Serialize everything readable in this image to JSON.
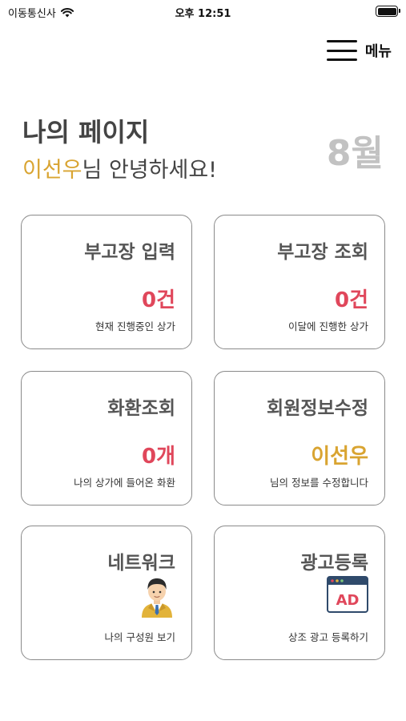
{
  "status_bar": {
    "carrier": "이동통신사",
    "time": "오후 12:51",
    "icons": [
      "wifi-icon",
      "battery-icon"
    ]
  },
  "header": {
    "menu_label": "메뉴",
    "menu_icon": "hamburger-icon"
  },
  "intro": {
    "title": "나의 페이지",
    "user_name": "이선우",
    "greeting_suffix": "님 안녕하세요!",
    "month": "8월"
  },
  "colors": {
    "accent_red": "#e0475b",
    "accent_gold": "#d9a431",
    "month_gray": "#c2c2c2"
  },
  "cards": [
    {
      "title": "부고장 입력",
      "value": "0건",
      "desc": "현재 진행중인 상가"
    },
    {
      "title": "부고장 조회",
      "value": "0건",
      "desc": "이달에 진행한 상가"
    },
    {
      "title": "화환조회",
      "value": "0개",
      "desc": "나의 상가에 들어온 화환"
    },
    {
      "title": "회원정보수정",
      "value": "이선우",
      "desc": "님의 정보를 수정합니다"
    },
    {
      "title": "네트워크",
      "icon": "businessman-icon",
      "desc": "나의 구성원 보기"
    },
    {
      "title": "광고등록",
      "icon": "ad-icon",
      "icon_text": "AD",
      "desc": "상조 광고 등록하기"
    }
  ]
}
